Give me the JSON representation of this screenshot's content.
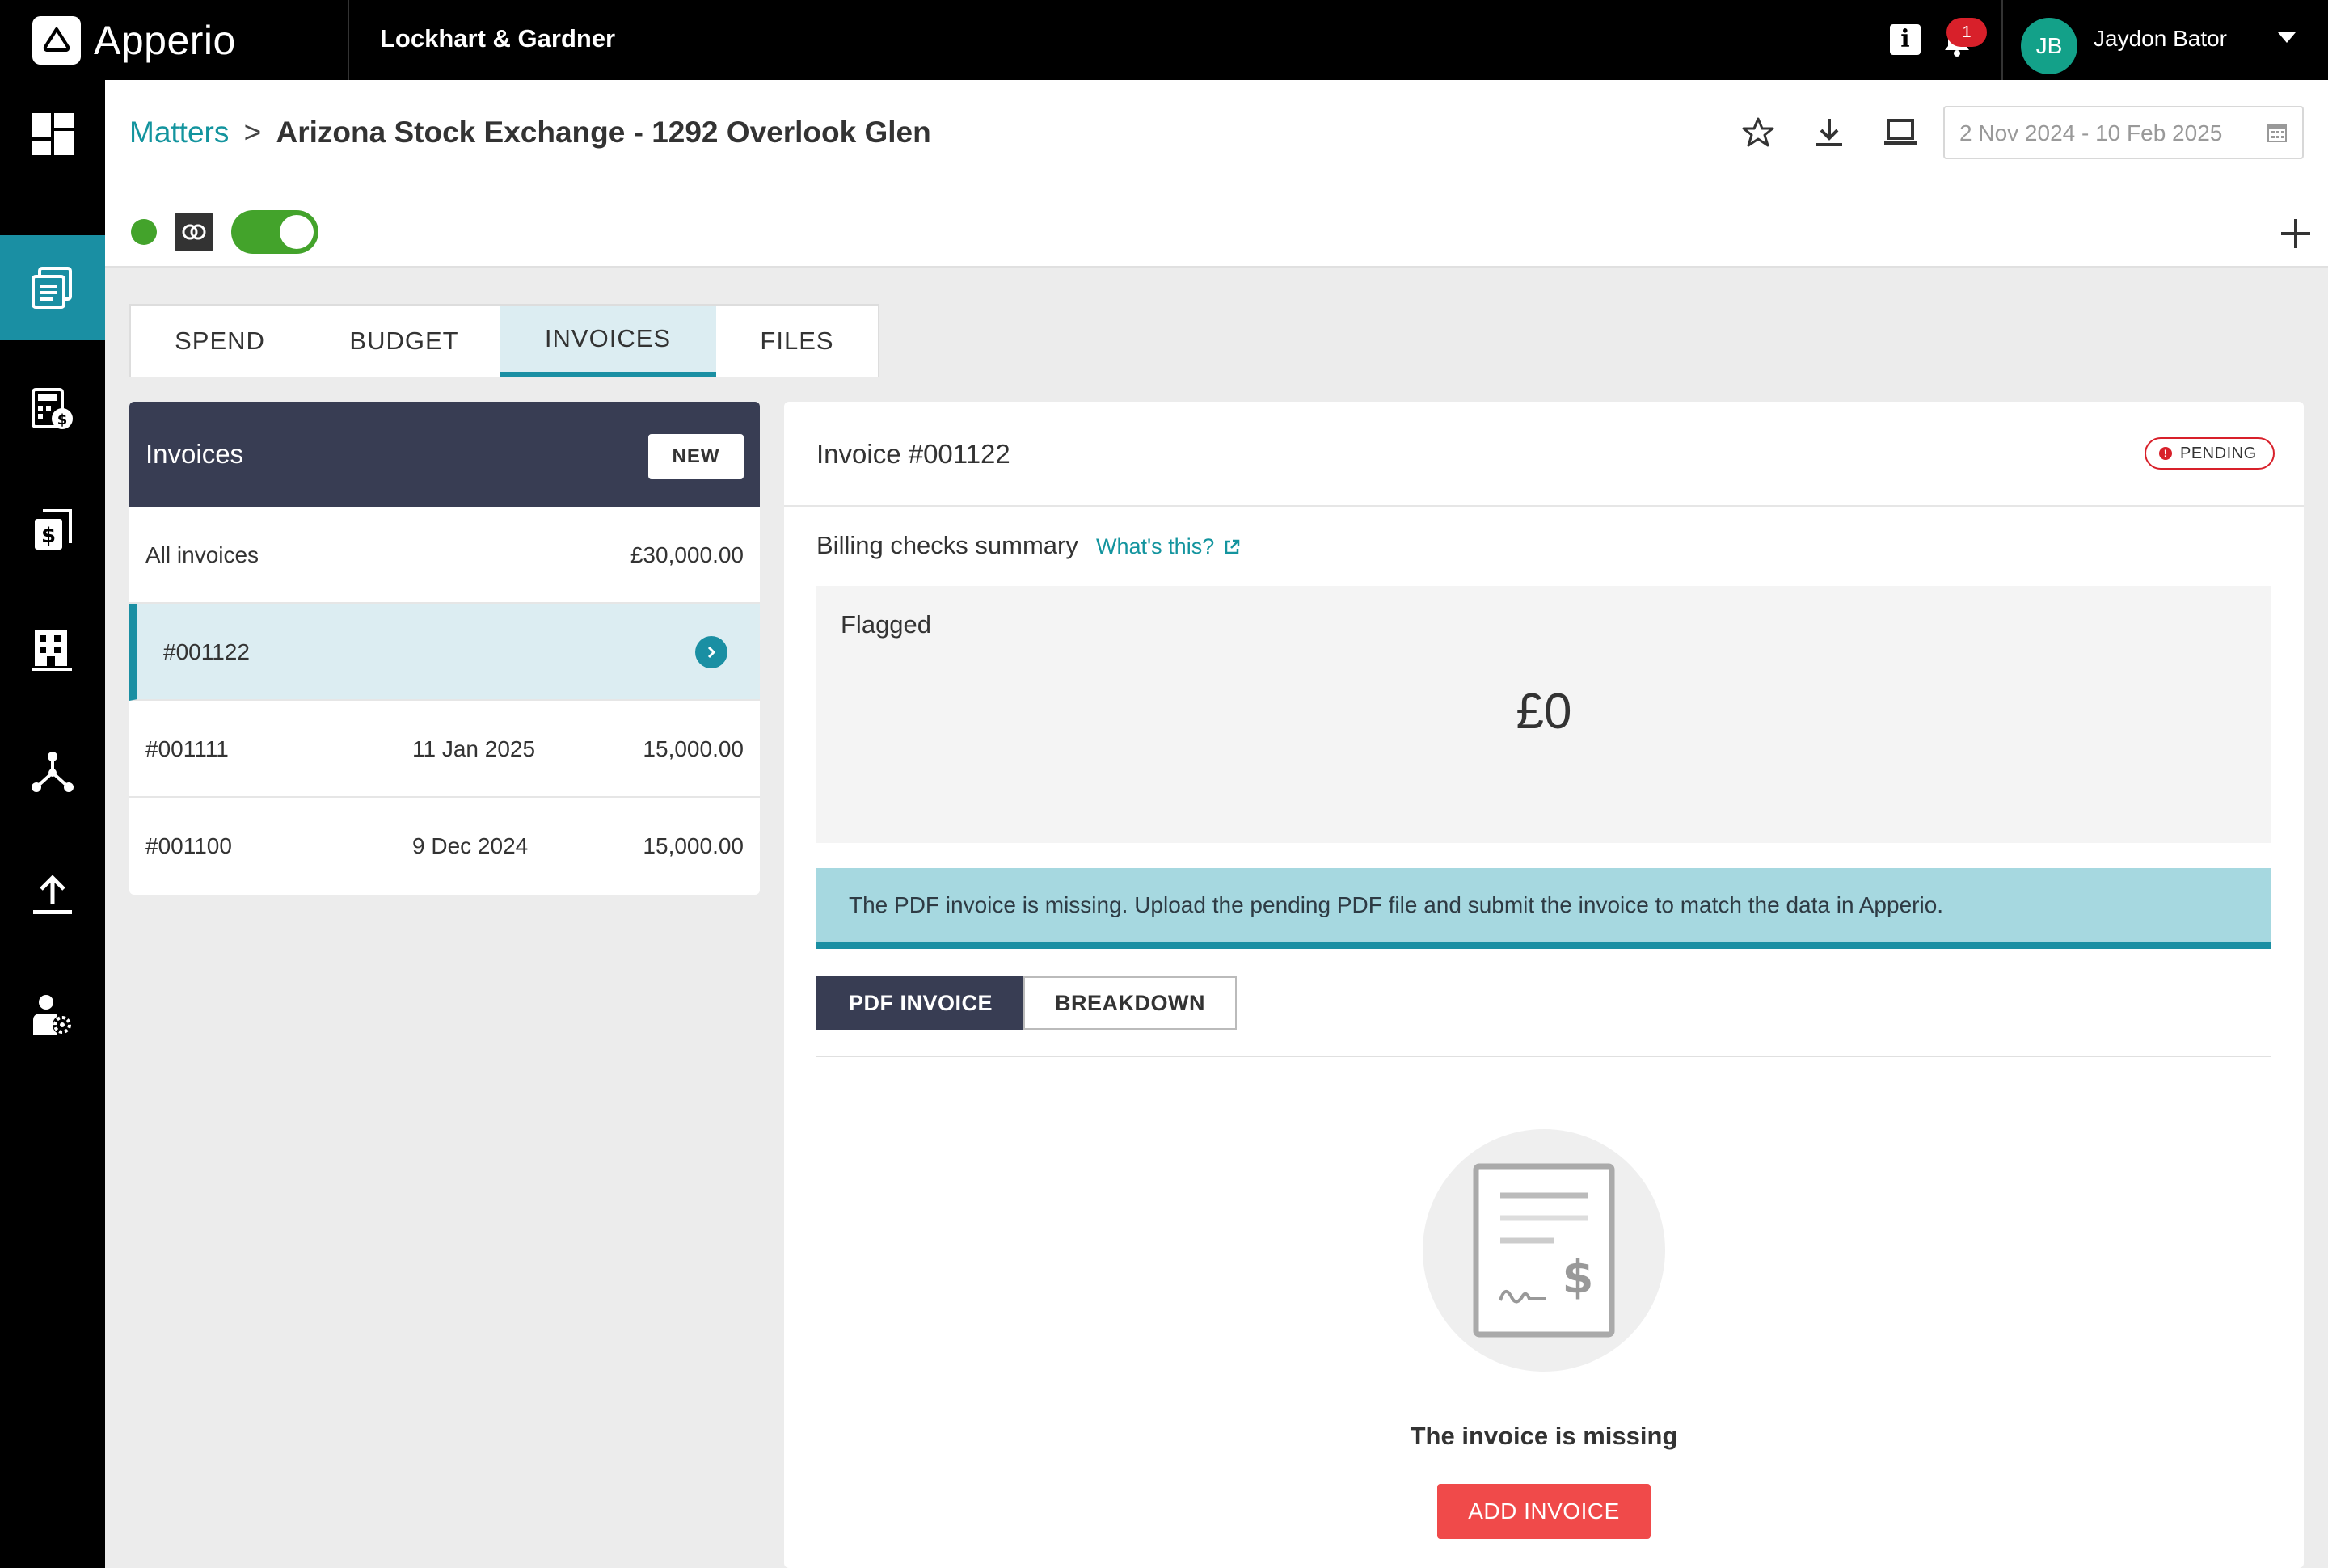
{
  "app": {
    "logo_text": "Apperio",
    "firm_name": "Lockhart & Gardner",
    "info_label": "i",
    "notification_count": "1",
    "user": {
      "initials": "JB",
      "name": "Jaydon Bator"
    },
    "accent_color": "#1a8fa3"
  },
  "sidenav": {
    "items": [
      {
        "name": "dashboard",
        "icon": "dashboard-icon",
        "active": false
      },
      {
        "name": "matters",
        "icon": "matters-icon",
        "active": true
      },
      {
        "name": "budgets",
        "icon": "budget-calculator-icon",
        "active": false
      },
      {
        "name": "invoices",
        "icon": "invoice-dollar-icon",
        "active": false
      },
      {
        "name": "firms",
        "icon": "building-icon",
        "active": false
      },
      {
        "name": "network",
        "icon": "network-icon",
        "active": false
      },
      {
        "name": "upload",
        "icon": "upload-icon",
        "active": false
      },
      {
        "name": "user-settings",
        "icon": "user-settings-icon",
        "active": false
      }
    ]
  },
  "header": {
    "breadcrumb_root": "Matters",
    "breadcrumb_sep": ">",
    "breadcrumb_current": "Arizona Stock Exchange - 1292 Overlook Glen",
    "date_range": "2 Nov 2024 - 10 Feb 2025",
    "status_color": "#43a32b",
    "toggle_on": true
  },
  "tabs": [
    {
      "label": "SPEND",
      "active": false
    },
    {
      "label": "BUDGET",
      "active": false
    },
    {
      "label": "INVOICES",
      "active": true
    },
    {
      "label": "FILES",
      "active": false
    }
  ],
  "invoices_panel": {
    "title": "Invoices",
    "new_label": "NEW",
    "all_label": "All invoices",
    "all_amount": "£30,000.00",
    "rows": [
      {
        "id": "#001122",
        "date": "",
        "amount": "",
        "selected": true
      },
      {
        "id": "#001111",
        "date": "11 Jan 2025",
        "amount": "15,000.00",
        "selected": false
      },
      {
        "id": "#001100",
        "date": "9 Dec 2024",
        "amount": "15,000.00",
        "selected": false
      }
    ]
  },
  "detail": {
    "title": "Invoice #001122",
    "status": "PENDING",
    "billing_label": "Billing checks summary",
    "whats_this": "What's this?",
    "flagged_label": "Flagged",
    "flagged_value": "£0",
    "alert": "The PDF invoice is missing. Upload the pending PDF file and submit the invoice to match the data in Apperio.",
    "seg_pdf": "PDF INVOICE",
    "seg_breakdown": "BREAKDOWN",
    "empty_text": "The invoice is missing",
    "add_invoice": "ADD INVOICE"
  }
}
